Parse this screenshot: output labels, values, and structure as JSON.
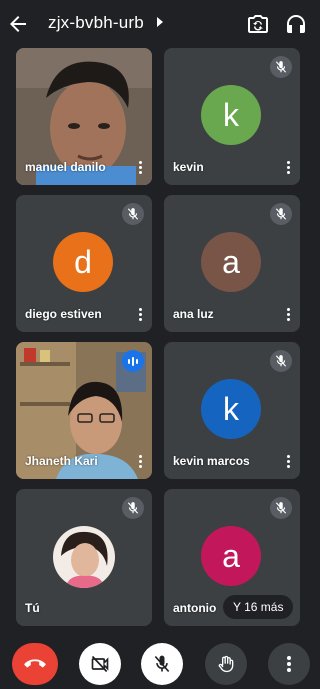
{
  "app": {
    "meeting_code": "zjx-bvbh-urb"
  },
  "colors": {
    "background": "#202124",
    "tile": "#3c4043",
    "active_outline": "#8ab4f8",
    "end_call": "#ea4335",
    "speaking": "#1a73e8"
  },
  "tiles": [
    {
      "name": "manuel danilo",
      "type": "video",
      "active": true,
      "muted": false
    },
    {
      "name": "kevin",
      "initial": "k",
      "avatar_color": "#6aa84f",
      "muted": true
    },
    {
      "name": "diego estiven",
      "initial": "d",
      "avatar_color": "#e8711a",
      "muted": true
    },
    {
      "name": "ana luz",
      "initial": "a",
      "avatar_color": "#795548",
      "muted": true
    },
    {
      "name": "Jhaneth Kari",
      "type": "video",
      "speaking": true
    },
    {
      "name": "kevin marcos",
      "initial": "k",
      "avatar_color": "#1565c0",
      "muted": true
    },
    {
      "name": "Tú",
      "type": "photo",
      "muted": true
    },
    {
      "name": "antonio",
      "initial": "a",
      "avatar_color": "#c2185b",
      "muted": true
    }
  ],
  "more_participants": "Y 16 más",
  "icons": {
    "back": "back-arrow-icon",
    "switch_camera": "switch-camera-icon",
    "audio_output": "headphones-icon",
    "mic_off": "mic-off-icon",
    "end_call": "end-call-icon",
    "camera_off": "camera-off-icon",
    "raise_hand": "raise-hand-icon",
    "more": "more-vert-icon"
  }
}
